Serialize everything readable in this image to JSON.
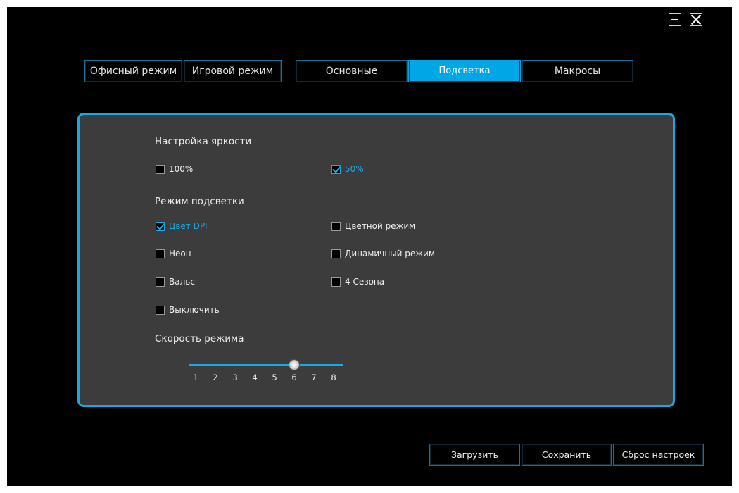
{
  "modes": [
    {
      "label": "Офисный режим"
    },
    {
      "label": "Игровой режим"
    }
  ],
  "tabs": [
    {
      "label": "Основные",
      "active": false
    },
    {
      "label": "Подсветка",
      "active": true
    },
    {
      "label": "Макросы",
      "active": false
    }
  ],
  "brightness": {
    "heading": "Настройка яркости",
    "options": [
      {
        "label": "100%",
        "checked": false
      },
      {
        "label": "50%",
        "checked": true
      }
    ]
  },
  "lighting": {
    "heading": "Режим подсветки",
    "options": [
      {
        "label": "Цвет DPI",
        "checked": true
      },
      {
        "label": "Цветной режим",
        "checked": false
      },
      {
        "label": "Неон",
        "checked": false
      },
      {
        "label": "Динамичный режим",
        "checked": false
      },
      {
        "label": "Вальс",
        "checked": false
      },
      {
        "label": "4 Сезона",
        "checked": false
      },
      {
        "label": "Выключить",
        "checked": false
      }
    ]
  },
  "speed": {
    "heading": "Скорость режима",
    "ticks": [
      "1",
      "2",
      "3",
      "4",
      "5",
      "6",
      "7",
      "8"
    ],
    "value": 6,
    "min": 1,
    "max": 8
  },
  "buttons": {
    "load": "Загрузить",
    "save": "Сохранить",
    "reset": "Сброс настроек"
  },
  "colors": {
    "accent": "#1aa8e0",
    "active_tab": "#00a6e6",
    "panel": "#3c3c3c",
    "background": "#000000"
  },
  "icons": {
    "minimize": "minimize-icon",
    "close": "close-icon",
    "checkbox_checked": "checkmark-icon"
  }
}
